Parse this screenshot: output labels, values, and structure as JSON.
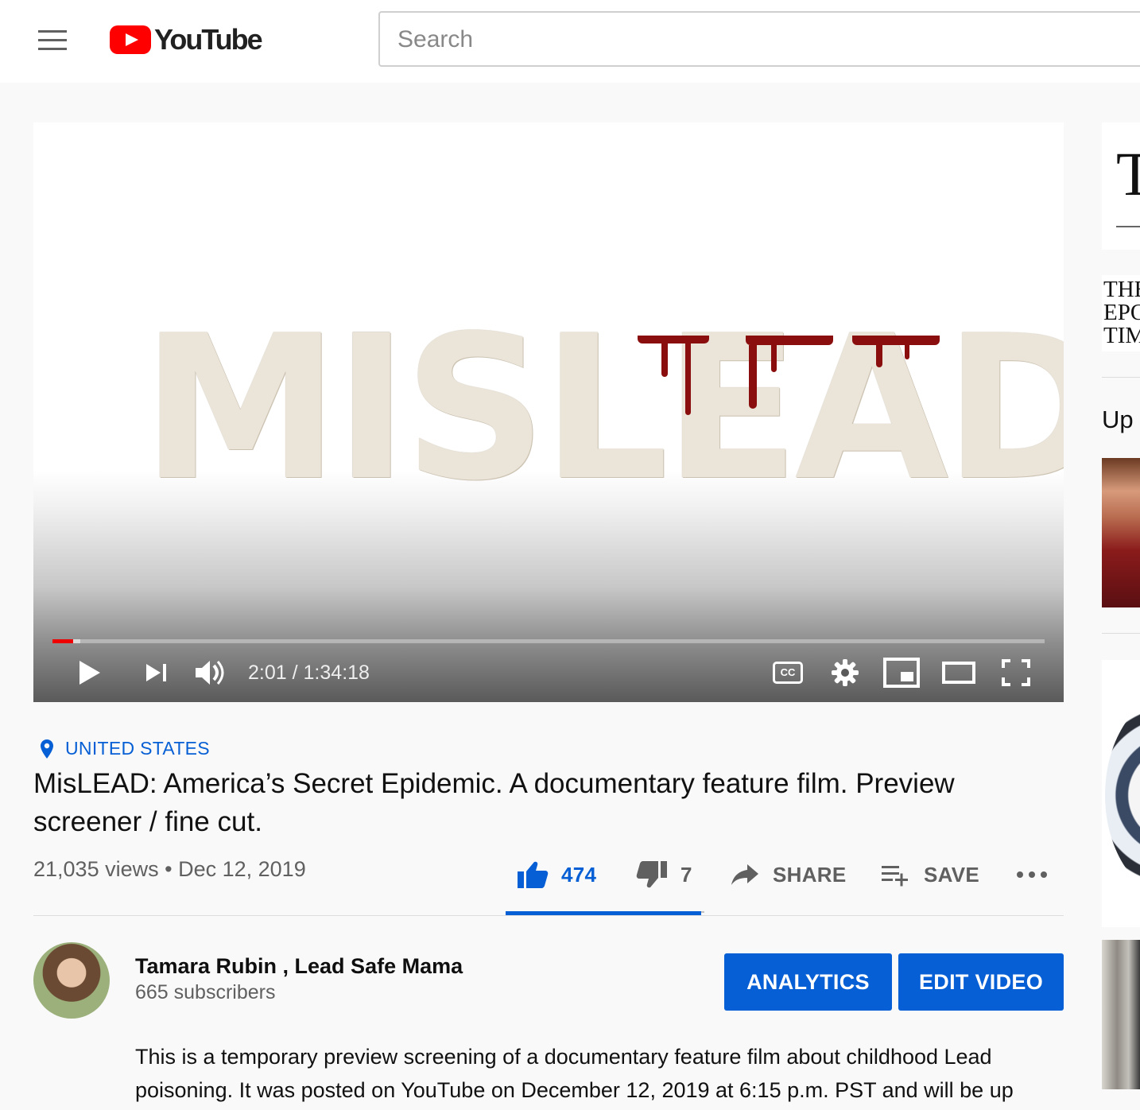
{
  "header": {
    "logo_text": "YouTube",
    "search_placeholder": "Search"
  },
  "player": {
    "title_art": "MISLEAD",
    "current_time": "2:01",
    "separator": "/",
    "duration": "1:34:18",
    "progress_fraction": 0.021,
    "buffer_fraction": 0.028,
    "cc_label": "CC"
  },
  "video": {
    "location": "UNITED STATES",
    "title": "MisLEAD: America’s Secret Epidemic. A documentary feature film. Preview screener / fine cut.",
    "views": "21,035 views",
    "dot": "•",
    "date": "Dec 12, 2019"
  },
  "actions": {
    "likes": "474",
    "dislikes": "7",
    "share_label": "SHARE",
    "save_label": "SAVE",
    "like_ratio": 0.985
  },
  "channel": {
    "name": "Tamara Rubin , Lead Safe Mama",
    "subscribers": "665 subscribers",
    "analytics_label": "ANALYTICS",
    "edit_label": "EDIT VIDEO"
  },
  "description": {
    "text": "This is a temporary preview screening of a documentary feature film about childhood Lead poisoning. It was posted on YouTube on December 12, 2019 at 6:15 p.m. PST and will be up"
  },
  "sidebar": {
    "ad_fragment_1": "T",
    "ad_fragment_2": "THE EPO TIM",
    "up_next_fragment": "Up"
  },
  "colors": {
    "brand_red": "#ff0000",
    "link_blue": "#065fd4",
    "blood_red": "#8a0e0e"
  }
}
